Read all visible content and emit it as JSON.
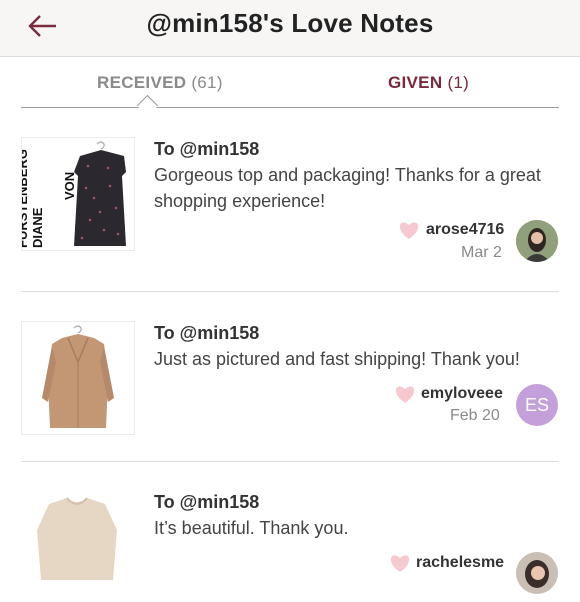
{
  "header": {
    "title": "@min158's Love Notes",
    "back_icon": "back-arrow-icon"
  },
  "tabs": {
    "received_label": "RECEIVED",
    "received_count": "(61)",
    "given_label": "GIVEN",
    "given_count": "(1)",
    "active": "received"
  },
  "colors": {
    "accent": "#7a2a3d",
    "heart": "#f6c9cf",
    "initials_avatar": "#c4a0da"
  },
  "notes": [
    {
      "to": "To @min158",
      "message": "Gorgeous top and packaging! Thanks for a great shopping experience!",
      "user": "arose4716",
      "date": "Mar 2",
      "thumb_brand": "DIANE VON FURSTENBERG"
    },
    {
      "to": "To @min158",
      "message": "Just as pictured and fast shipping! Thank you!",
      "user": "emyloveee",
      "date": "Feb 20",
      "avatar_initials": "ES"
    },
    {
      "to": "To @min158",
      "message": "It’s beautiful. Thank you.",
      "user": "rachelesme"
    }
  ]
}
